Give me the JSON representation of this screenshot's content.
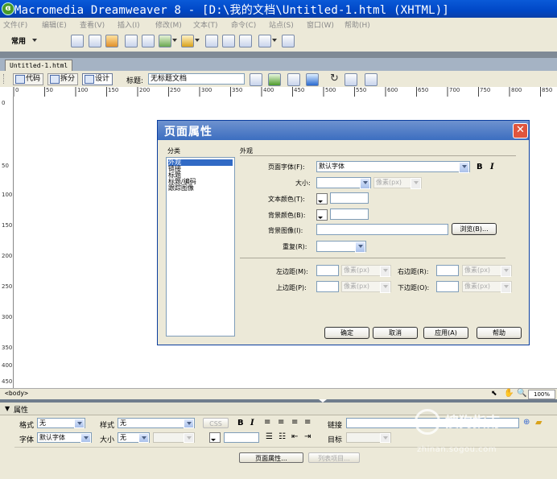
{
  "window": {
    "title": "Macromedia Dreamweaver 8 - [D:\\我的文档\\Untitled-1.html (XHTML)]"
  },
  "menu": [
    "文件(F)",
    "编辑(E)",
    "查看(V)",
    "插入(I)",
    "修改(M)",
    "文本(T)",
    "命令(C)",
    "站点(S)",
    "窗口(W)",
    "帮助(H)"
  ],
  "insert_bar": {
    "category": "常用"
  },
  "document": {
    "tab": "Untitled-1.html",
    "views": {
      "code": "代码",
      "split": "拆分",
      "design": "设计"
    },
    "title_label": "标题:",
    "title_value": "无标题文档",
    "status_tag": "<body>",
    "zoom": "100%"
  },
  "ruler": {
    "top": [
      "0",
      "50",
      "100",
      "150",
      "200",
      "250",
      "300",
      "350",
      "400",
      "450",
      "500",
      "550",
      "600",
      "650",
      "700",
      "750",
      "800",
      "850"
    ],
    "left": [
      "0",
      "50",
      "100",
      "150",
      "200",
      "250",
      "300",
      "350",
      "400",
      "450"
    ]
  },
  "dialog": {
    "title": "页面属性",
    "category_header": "分类",
    "section_header": "外观",
    "categories": [
      "外观",
      "链接",
      "标题",
      "标题/编码",
      "跟踪图像"
    ],
    "selected_category": "外观",
    "page_font_label": "页面字体(F):",
    "page_font_value": "默认字体",
    "bold": "B",
    "italic": "I",
    "size_label": "大小:",
    "size_unit": "像素(px)",
    "text_color_label": "文本颜色(T):",
    "bg_color_label": "背景颜色(B):",
    "bg_image_label": "背景图像(I):",
    "browse_button": "浏览(B)...",
    "repeat_label": "重复(R):",
    "left_margin_label": "左边距(M):",
    "right_margin_label": "右边距(R):",
    "top_margin_label": "上边距(P):",
    "bottom_margin_label": "下边距(O):",
    "margin_unit": "像素(px)",
    "buttons": {
      "ok": "确定",
      "cancel": "取消",
      "apply": "应用(A)",
      "help": "帮助"
    }
  },
  "properties": {
    "header": "属性",
    "format_label": "格式",
    "format_value": "无",
    "style_label": "样式",
    "style_value": "无",
    "css_button": "CSS",
    "font_label": "字体",
    "font_value": "默认字体",
    "size_label": "大小",
    "size_value": "无",
    "link_label": "链接",
    "target_label": "目标",
    "page_props_button": "页面属性...",
    "list_items_button": "列表项目..."
  },
  "watermark": {
    "brand": "搜狗指南",
    "url": "zhinan.sogou.com"
  }
}
